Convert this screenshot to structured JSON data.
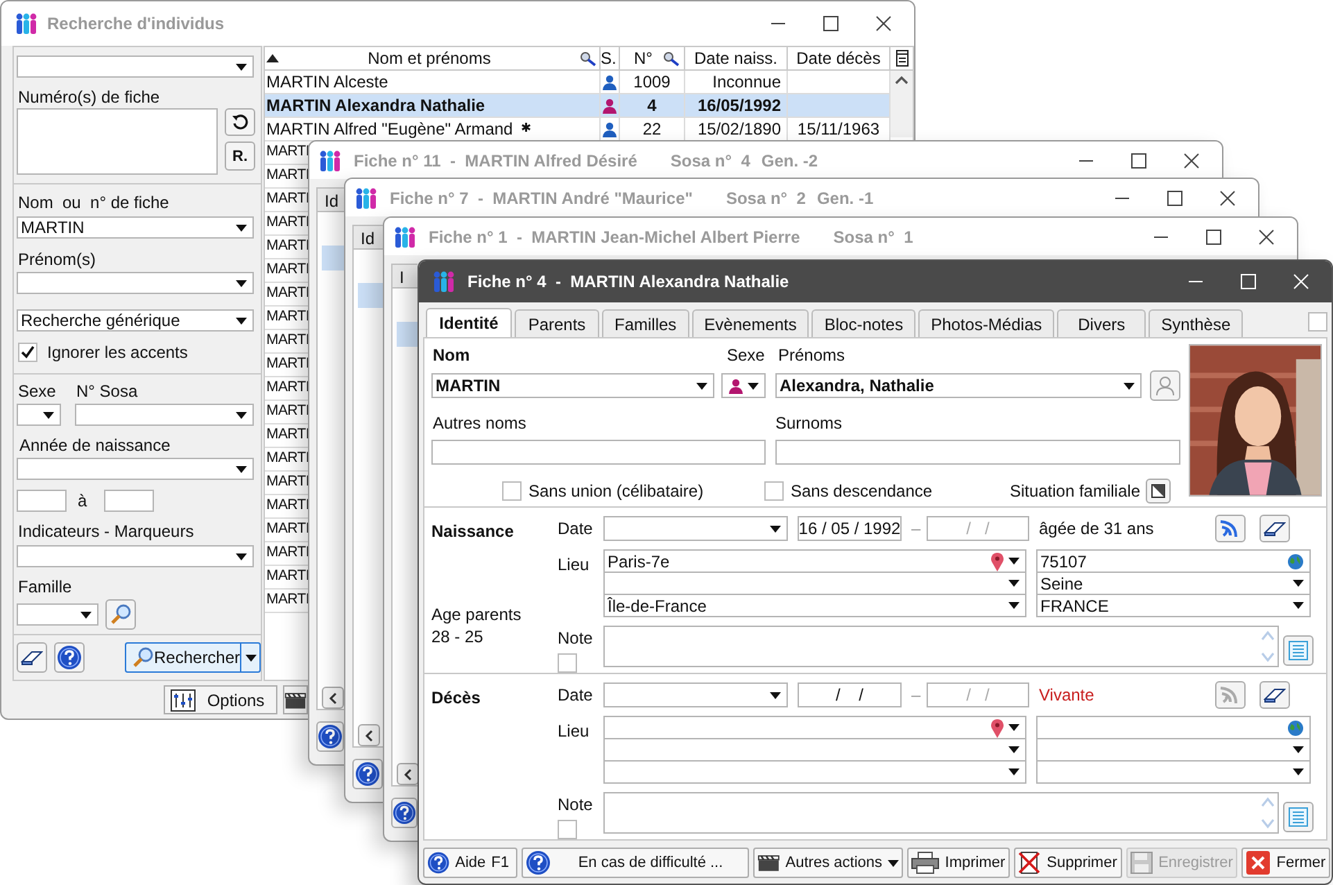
{
  "search_window": {
    "title": "Recherche d'individus",
    "filters": {
      "numbers_label": "Numéro(s) de fiche",
      "reset_button": "R.",
      "name_label": "Nom  ou  n° de fiche",
      "name_value": "MARTIN",
      "firstname_label": "Prénom(s)",
      "search_mode": "Recherche générique",
      "ignore_accents": {
        "label": "Ignorer les accents",
        "checked": true
      },
      "sex_label": "Sexe",
      "sosa_label": "N° Sosa",
      "birth_year_label": "Année de naissance",
      "range_to": "à",
      "markers_label": "Indicateurs - Marqueurs",
      "family_label": "Famille",
      "search_button": "Rechercher"
    },
    "table": {
      "columns": [
        "Nom et prénoms",
        "S.",
        "N°",
        "Date naiss.",
        "Date décès"
      ],
      "rows": [
        {
          "name": "MARTIN Alceste",
          "color": "#1f5fbf",
          "number": "1009",
          "birth": "Inconnue",
          "selected": false
        },
        {
          "name": "MARTIN Alexandra Nathalie",
          "color": "#b3166f",
          "number": "4",
          "birth": "16/05/1992",
          "selected": true
        },
        {
          "name": "MARTIN Alfred \"Eugène\" Armand",
          "mark": "✱",
          "color": "#1f5fbf",
          "number": "22",
          "birth": "15/02/1890",
          "death": "15/11/1963",
          "selected": false
        },
        {
          "name": "MARTI",
          "selected": false
        },
        {
          "name": "MARTI",
          "selected": false
        },
        {
          "name": "MARTI",
          "selected": false
        },
        {
          "name": "MARTI",
          "selected": false
        },
        {
          "name": "MARTI",
          "selected": false
        },
        {
          "name": "MARTI",
          "selected": false
        },
        {
          "name": "MARTI",
          "selected": false
        },
        {
          "name": "MARTI",
          "selected": false
        },
        {
          "name": "MARTI",
          "selected": false
        },
        {
          "name": "MARTI",
          "selected": false
        },
        {
          "name": "MARTI",
          "selected": false
        },
        {
          "name": "MARTI",
          "selected": false
        },
        {
          "name": "MARTI",
          "selected": false
        },
        {
          "name": "MARTI",
          "selected": false
        },
        {
          "name": "MARTI",
          "selected": false
        },
        {
          "name": "MARTI",
          "selected": false
        },
        {
          "name": "MARTI",
          "selected": false
        },
        {
          "name": "MARTI",
          "selected": false
        },
        {
          "name": "MARTI",
          "selected": false
        },
        {
          "name": "MARTI",
          "selected": false
        }
      ]
    },
    "options_button": "Options"
  },
  "back_records": [
    {
      "title": "Fiche n° 11  -  MARTIN Alfred Désiré",
      "sosa": "Sosa n°  4",
      "generation": "Gen. -2",
      "active": false,
      "tab_stub": "Id"
    },
    {
      "title": "Fiche n° 7  -  MARTIN André \"Maurice\"",
      "sosa": "Sosa n°  2",
      "generation": "Gen. -1",
      "active": false,
      "tab_stub": "Id"
    },
    {
      "title": "Fiche n° 1  -  MARTIN Jean-Michel Albert Pierre",
      "sosa": "Sosa n°  1",
      "active": false,
      "tab_stub": "I"
    }
  ],
  "record": {
    "title": "Fiche n° 4  -  MARTIN Alexandra Nathalie",
    "active": true,
    "tabs": [
      {
        "label": "Identité",
        "selected": true
      },
      {
        "label": "Parents",
        "selected": false
      },
      {
        "label": "Familles",
        "selected": false
      },
      {
        "label": "Evènements",
        "selected": false
      },
      {
        "label": "Bloc-notes",
        "selected": false
      },
      {
        "label": "Photos-Médias",
        "selected": false
      },
      {
        "label": "Divers",
        "selected": false
      },
      {
        "label": "Synthèse",
        "selected": false
      }
    ],
    "corner_checkbox": {
      "checked": false
    },
    "identity": {
      "name_label": "Nom",
      "name": "MARTIN",
      "sex_label": "Sexe",
      "sex": {
        "color": "#b3166f"
      },
      "firstnames_label": "Prénoms",
      "firstnames": "Alexandra, Nathalie",
      "other_names_label": "Autres noms",
      "nicknames_label": "Surnoms",
      "no_union": {
        "label": "Sans union (célibataire)",
        "checked": false
      },
      "no_descendants": {
        "label": "Sans descendance",
        "checked": false
      },
      "family_situation": "Situation familiale"
    },
    "birth": {
      "label": "Naissance",
      "date_label": "Date",
      "date": "16 / 05 / 1992",
      "date2_placeholder": "/   /",
      "dash": "–",
      "age": "âgée de 31 ans",
      "place_label": "Lieu",
      "place": "Paris-7e",
      "code": "75107",
      "department": "Seine",
      "region": "Île-de-France",
      "country": "FRANCE",
      "parents_age_label": "Age parents",
      "parents_age": "28 - 25",
      "note_label": "Note",
      "note_checked": false
    },
    "death": {
      "label": "Décès",
      "date_label": "Date",
      "date": "/    /",
      "date2_placeholder": "/   /",
      "dash": "–",
      "status": "Vivante",
      "place_label": "Lieu",
      "note_label": "Note",
      "note_checked": false
    },
    "buttons": [
      {
        "label": "Aide",
        "shortcut": "F1",
        "kind": "help",
        "disabled": false
      },
      {
        "label": "En cas de difficulté ...",
        "kind": "help",
        "disabled": false
      },
      {
        "label": "Autres actions",
        "kind": "actions",
        "disabled": false
      },
      {
        "label": "Imprimer",
        "kind": "print",
        "disabled": false
      },
      {
        "label": "Supprimer",
        "kind": "delete",
        "disabled": false
      },
      {
        "label": "Enregistrer",
        "kind": "save",
        "disabled": true
      },
      {
        "label": "Fermer",
        "kind": "close",
        "disabled": false
      }
    ]
  }
}
